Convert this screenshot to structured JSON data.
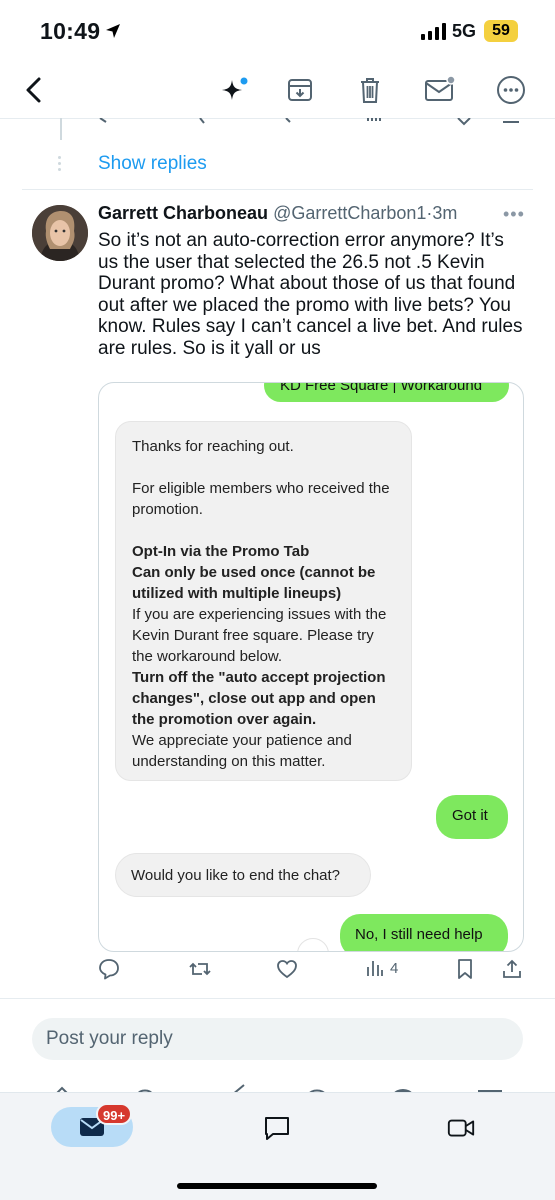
{
  "status_bar": {
    "time": "10:49",
    "network": "5G",
    "battery": "59"
  },
  "nav": {
    "icons": [
      "back-arrow-icon",
      "grok-sparkle-icon",
      "archive-icon",
      "trash-icon",
      "mail-icon",
      "more-circle-icon"
    ]
  },
  "thread": {
    "show_replies": "Show replies"
  },
  "tweet": {
    "name": "Garrett Charboneau",
    "handle": "@GarrettCharbon1",
    "separator": "·",
    "time": "3m",
    "text": "So it’s not an auto-correction error anymore? It’s us the user that selected the 26.5 not .5 Kevin Durant promo? What about those of us that found out after we placed the promo with live bets? You know. Rules say I can’t cancel a live bet. And rules are rules. So is it yall or us",
    "views": "4"
  },
  "media": {
    "top_green": "KD Free Square | Workaround",
    "agent_msg": {
      "p1": "Thanks for reaching out.",
      "p2": "For eligible members who received the promotion.",
      "p3_bold": "Opt-In via the Promo Tab",
      "p4_bold": "Can only be used once (cannot be utilized with multiple lineups)",
      "p5": "If you are experiencing issues with the Kevin Durant free square. Please try the workaround below.",
      "p6_bold": "Turn off the \"auto accept projection changes\", close out app and open the promotion over again.",
      "p7": "We appreciate your patience and understanding on this matter."
    },
    "user_reply1": "Got it",
    "agent_msg2": "Would you like to end the chat?",
    "user_reply2": "No, I still need help"
  },
  "reply": {
    "placeholder": "Post your reply"
  },
  "tabbar": {
    "badge": "99+"
  },
  "colors": {
    "accent": "#1d9bf0",
    "bubble_green": "#7ee85e",
    "badge_red": "#d6382e"
  }
}
